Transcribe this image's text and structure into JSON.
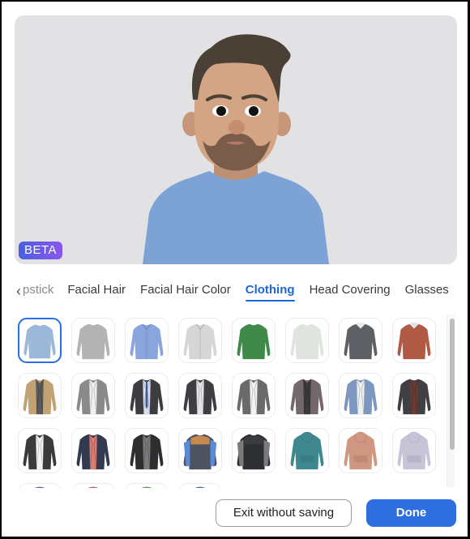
{
  "preview": {
    "badge": "BETA",
    "avatar_description": "3D avatar with dark brown hair, beard, blue crewneck sweater"
  },
  "tabs": {
    "back_icon": "chevron-left-icon",
    "items": [
      {
        "label": "pstick",
        "state": "partial"
      },
      {
        "label": "Facial Hair",
        "state": "normal"
      },
      {
        "label": "Facial Hair Color",
        "state": "normal"
      },
      {
        "label": "Clothing",
        "state": "active"
      },
      {
        "label": "Head Covering",
        "state": "normal"
      },
      {
        "label": "Glasses",
        "state": "normal"
      }
    ]
  },
  "clothing": {
    "selected_index": 0,
    "items": [
      {
        "name": "Light blue crewneck sweater",
        "type": "sweater",
        "color": "#9cb8d9",
        "inner": ""
      },
      {
        "name": "Gray crewneck sweater",
        "type": "sweater",
        "color": "#b3b3b3",
        "inner": ""
      },
      {
        "name": "Blue button-up shirt",
        "type": "shirt",
        "color": "#8aa5dd",
        "inner": ""
      },
      {
        "name": "Light gray zip jacket",
        "type": "shirt",
        "color": "#d6d6d6",
        "inner": ""
      },
      {
        "name": "Green turtleneck",
        "type": "sweater",
        "color": "#3f8a49",
        "inner": ""
      },
      {
        "name": "Off-white turtleneck",
        "type": "sweater",
        "color": "#dfe4df",
        "inner": ""
      },
      {
        "name": "Dark gray sweater with collar",
        "type": "sweater",
        "color": "#5d6166",
        "inner": "#e8e8ee"
      },
      {
        "name": "Rust sweater with collar",
        "type": "sweater",
        "color": "#b05a45",
        "inner": "#e0e4ee"
      },
      {
        "name": "Tan overcoat",
        "type": "blazer",
        "color": "#c2a172",
        "inner": "#5a5a5e"
      },
      {
        "name": "Gray tweed blazer",
        "type": "blazer",
        "color": "#8a8a8a",
        "inner": "#f0f0f0"
      },
      {
        "name": "Dark suit with blue tie",
        "type": "blazer",
        "color": "#3c3d40",
        "inner": "#d8dde8"
      },
      {
        "name": "Charcoal suit",
        "type": "blazer",
        "color": "#3d3e41",
        "inner": "#e4e4e6"
      },
      {
        "name": "Gray blazer white shirt",
        "type": "blazer",
        "color": "#6a6a6c",
        "inner": "#f2f2f2"
      },
      {
        "name": "Brown plaid blazer",
        "type": "blazer",
        "color": "#74686a",
        "inner": "#3a3a3c"
      },
      {
        "name": "Blue blazer",
        "type": "blazer",
        "color": "#7d97c0",
        "inner": "#f0f0f0"
      },
      {
        "name": "Dark blazer maroon shirt",
        "type": "blazer",
        "color": "#3f3f44",
        "inner": "#6a3a35"
      },
      {
        "name": "Black blazer white tee",
        "type": "blazer",
        "color": "#3a3a3d",
        "inner": "#f2f2f2"
      },
      {
        "name": "Navy blazer coral tee",
        "type": "blazer",
        "color": "#323a52",
        "inner": "#d87d70"
      },
      {
        "name": "Leather jacket with hoodie",
        "type": "blazer",
        "color": "#2e2e30",
        "inner": "#7a7a7c"
      },
      {
        "name": "Puffer vest over blue shirt",
        "type": "vest",
        "color": "#4e5360",
        "inner": "#5b8ad8",
        "accent": "#c78a4c"
      },
      {
        "name": "Black puffer vest",
        "type": "vest",
        "color": "#2d2f33",
        "inner": "#7b7b7d",
        "accent": "#3a3c40"
      },
      {
        "name": "Teal hoodie",
        "type": "hoodie",
        "color": "#3f8890",
        "inner": ""
      },
      {
        "name": "Salmon hoodie",
        "type": "hoodie",
        "color": "#cf9680",
        "inner": ""
      },
      {
        "name": "Lavender hoodie",
        "type": "hoodie",
        "color": "#c8c4d8",
        "inner": ""
      },
      {
        "name": "Partially visible item",
        "type": "partial",
        "color": "#5a6a8a",
        "inner": ""
      },
      {
        "name": "Partially visible item",
        "type": "partial",
        "color": "#a0606a",
        "inner": ""
      },
      {
        "name": "Partially visible item",
        "type": "partial",
        "color": "#5a8a5a",
        "inner": ""
      },
      {
        "name": "Partially visible item",
        "type": "partial",
        "color": "#4a6a8a",
        "inner": ""
      }
    ]
  },
  "footer": {
    "exit_label": "Exit without saving",
    "done_label": "Done"
  },
  "colors": {
    "accent": "#2e6fdf",
    "preview_bg": "#e2e1e4"
  }
}
